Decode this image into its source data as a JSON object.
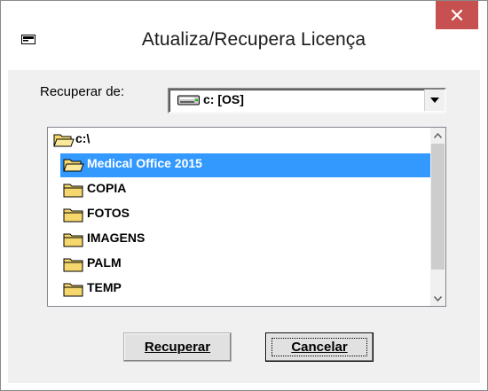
{
  "window": {
    "title": "Atualiza/Recupera Licença",
    "icon": "window-card-icon",
    "close_icon": "close-icon"
  },
  "form": {
    "recuperar_label": "Recuperar de:",
    "drive_value": "c: [OS]",
    "drive_icon": "drive-icon"
  },
  "folders": {
    "root": "c:\\",
    "items": [
      {
        "label": "Medical Office 2015",
        "state": "open",
        "selected": true
      },
      {
        "label": "COPIA",
        "state": "closed",
        "selected": false
      },
      {
        "label": "FOTOS",
        "state": "closed",
        "selected": false
      },
      {
        "label": "IMAGENS",
        "state": "closed",
        "selected": false
      },
      {
        "label": "PALM",
        "state": "closed",
        "selected": false
      },
      {
        "label": "TEMP",
        "state": "closed",
        "selected": false
      }
    ]
  },
  "buttons": {
    "recuperar": "Recuperar",
    "cancelar": "Cancelar"
  },
  "colors": {
    "selection": "#3399ff",
    "close_button": "#c75050",
    "folder": "#f5d76e"
  }
}
